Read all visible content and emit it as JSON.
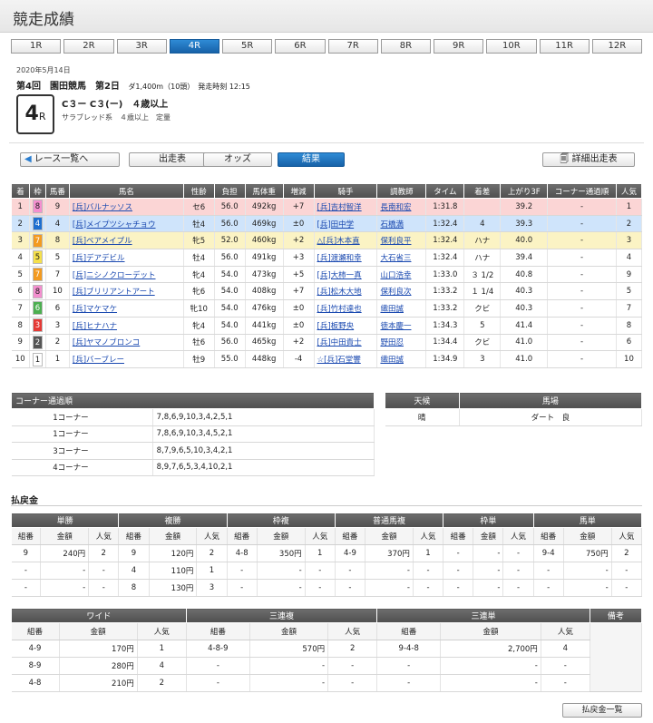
{
  "page_title": "競走成績",
  "race_tabs": [
    "1R",
    "2R",
    "3R",
    "4R",
    "5R",
    "6R",
    "7R",
    "8R",
    "9R",
    "10R",
    "11R",
    "12R"
  ],
  "race_info": {
    "date": "2020年5月14日",
    "meeting": "第4回　園田競馬　第2日",
    "course_time": "ダ1,400m（10頭）　発走時刻 12:15",
    "race_number": "4",
    "race_suffix": "R",
    "condition": "C３ー C３(ー)　４歳以上",
    "breed": "サラブレッド系　４歳以上　定量"
  },
  "actions": {
    "back": "レース一覧へ",
    "entries": "出走表",
    "odds": "オッズ",
    "result": "結果",
    "detail": "詳細出走表"
  },
  "results": {
    "headers": [
      "着",
      "枠",
      "馬番",
      "馬名",
      "性齢",
      "負担",
      "馬体重",
      "増減",
      "騎手",
      "調教師",
      "タイム",
      "着差",
      "上がり3F",
      "コーナー通過順",
      "人気"
    ],
    "rows": [
      {
        "pos": "1",
        "waku": "8",
        "num": "9",
        "horse": "[兵]バルナッソス",
        "sex_age": "セ6",
        "weight": "56.0",
        "body": "492kg",
        "diff": "+7",
        "jockey": "[兵]吉村智洋",
        "trainer": "長南和宏",
        "time": "1:31.8",
        "margin": "",
        "f3": "39.2",
        "corner": "-",
        "pop": "1"
      },
      {
        "pos": "2",
        "waku": "4",
        "num": "4",
        "horse": "[兵]メイプツシャチョウ",
        "sex_age": "牡4",
        "weight": "56.0",
        "body": "469kg",
        "diff": "±0",
        "jockey": "[兵]田中学",
        "trainer": "石橋満",
        "time": "1:32.4",
        "margin": "4",
        "f3": "39.3",
        "corner": "-",
        "pop": "2"
      },
      {
        "pos": "3",
        "waku": "7",
        "num": "8",
        "horse": "[兵]ベアメイプル",
        "sex_age": "牝5",
        "weight": "52.0",
        "body": "460kg",
        "diff": "+2",
        "jockey": "△[兵]木本直",
        "trainer": "保利良平",
        "time": "1:32.4",
        "margin": "ハナ",
        "f3": "40.0",
        "corner": "-",
        "pop": "3"
      },
      {
        "pos": "4",
        "waku": "5",
        "num": "5",
        "horse": "[兵]デアデビル",
        "sex_age": "牡4",
        "weight": "56.0",
        "body": "491kg",
        "diff": "+3",
        "jockey": "[兵]渡瀬和幸",
        "trainer": "大石省三",
        "time": "1:32.4",
        "margin": "ハナ",
        "f3": "39.4",
        "corner": "-",
        "pop": "4"
      },
      {
        "pos": "5",
        "waku": "7",
        "num": "7",
        "horse": "[兵]ニシノクローデット",
        "sex_age": "牝4",
        "weight": "54.0",
        "body": "473kg",
        "diff": "+5",
        "jockey": "[兵]大柿一真",
        "trainer": "山口浩幸",
        "time": "1:33.0",
        "margin": "３ 1/2",
        "f3": "40.8",
        "corner": "-",
        "pop": "9"
      },
      {
        "pos": "6",
        "waku": "8",
        "num": "10",
        "horse": "[兵]ブリリアントアート",
        "sex_age": "牝6",
        "weight": "54.0",
        "body": "408kg",
        "diff": "+7",
        "jockey": "[兵]松木大地",
        "trainer": "保利良次",
        "time": "1:33.2",
        "margin": "１ 1/4",
        "f3": "40.3",
        "corner": "-",
        "pop": "5"
      },
      {
        "pos": "7",
        "waku": "6",
        "num": "6",
        "horse": "[兵]マケマケ",
        "sex_age": "牝10",
        "weight": "54.0",
        "body": "476kg",
        "diff": "±0",
        "jockey": "[兵]竹村達也",
        "trainer": "織田誠",
        "time": "1:33.2",
        "margin": "クビ",
        "f3": "40.3",
        "corner": "-",
        "pop": "7"
      },
      {
        "pos": "8",
        "waku": "3",
        "num": "3",
        "horse": "[兵]ヒナハナ",
        "sex_age": "牝4",
        "weight": "54.0",
        "body": "441kg",
        "diff": "±0",
        "jockey": "[兵]板野央",
        "trainer": "徳本慶一",
        "time": "1:34.3",
        "margin": "5",
        "f3": "41.4",
        "corner": "-",
        "pop": "8"
      },
      {
        "pos": "9",
        "waku": "2",
        "num": "2",
        "horse": "[兵]ヤマノブロンコ",
        "sex_age": "牡6",
        "weight": "56.0",
        "body": "465kg",
        "diff": "+2",
        "jockey": "[兵]中田貴士",
        "trainer": "野田忍",
        "time": "1:34.4",
        "margin": "クビ",
        "f3": "41.0",
        "corner": "-",
        "pop": "6"
      },
      {
        "pos": "10",
        "waku": "1",
        "num": "1",
        "horse": "[兵]バーブレー",
        "sex_age": "牡9",
        "weight": "55.0",
        "body": "448kg",
        "diff": "-4",
        "jockey": "☆[兵]石堂響",
        "trainer": "織田誠",
        "time": "1:34.9",
        "margin": "3",
        "f3": "41.0",
        "corner": "-",
        "pop": "10"
      }
    ]
  },
  "waku_colors": {
    "1": {
      "bg": "#ffffff",
      "fg": "#222222"
    },
    "2": {
      "bg": "#555555",
      "fg": "#ffffff"
    },
    "3": {
      "bg": "#e53935",
      "fg": "#ffffff"
    },
    "4": {
      "bg": "#1e6fd0",
      "fg": "#ffffff"
    },
    "5": {
      "bg": "#f5e04b",
      "fg": "#222222"
    },
    "6": {
      "bg": "#4caf50",
      "fg": "#ffffff"
    },
    "7": {
      "bg": "#f39a1f",
      "fg": "#ffffff"
    },
    "8": {
      "bg": "#f48fcf",
      "fg": "#222222"
    }
  },
  "corner_passing": {
    "title": "コーナー通過順",
    "rows": [
      {
        "label": "1コーナー",
        "value": "7,8,6,9,10,3,4,2,5,1"
      },
      {
        "label": "1コーナー",
        "value": "7,8,6,9,10,3,4,5,2,1"
      },
      {
        "label": "3コーナー",
        "value": "8,7,9,6,5,10,3,4,2,1"
      },
      {
        "label": "4コーナー",
        "value": "8,9,7,6,5,3,4,10,2,1"
      }
    ]
  },
  "weather": {
    "weather_label": "天候",
    "track_label": "馬場",
    "weather": "晴",
    "track": "ダート　良"
  },
  "payout_title": "払戻金",
  "payout1": {
    "groups": [
      "単勝",
      "複勝",
      "枠複",
      "普通馬複",
      "枠単",
      "馬単"
    ],
    "subheaders": [
      "組番",
      "金額",
      "人気"
    ],
    "rows": [
      [
        "9",
        "240円",
        "2",
        "9",
        "120円",
        "2",
        "4-8",
        "350円",
        "1",
        "4-9",
        "370円",
        "1",
        "-",
        "-",
        "-",
        "9-4",
        "750円",
        "2"
      ],
      [
        "-",
        "-",
        "-",
        "4",
        "110円",
        "1",
        "-",
        "-",
        "-",
        "-",
        "-",
        "-",
        "-",
        "-",
        "-",
        "-",
        "-",
        "-"
      ],
      [
        "-",
        "-",
        "-",
        "8",
        "130円",
        "3",
        "-",
        "-",
        "-",
        "-",
        "-",
        "-",
        "-",
        "-",
        "-",
        "-",
        "-",
        "-"
      ]
    ]
  },
  "payout2": {
    "groups": [
      "ワイド",
      "三連複",
      "三連単",
      "備考"
    ],
    "subheaders": [
      "組番",
      "金額",
      "人気"
    ],
    "rows": [
      [
        "4-9",
        "170円",
        "1",
        "4-8-9",
        "570円",
        "2",
        "9-4-8",
        "2,700円",
        "4"
      ],
      [
        "8-9",
        "280円",
        "4",
        "-",
        "-",
        "-",
        "-",
        "-",
        "-"
      ],
      [
        "4-8",
        "210円",
        "2",
        "-",
        "-",
        "-",
        "-",
        "-",
        "-"
      ]
    ]
  },
  "payout_list_button": "払戻金一覧"
}
